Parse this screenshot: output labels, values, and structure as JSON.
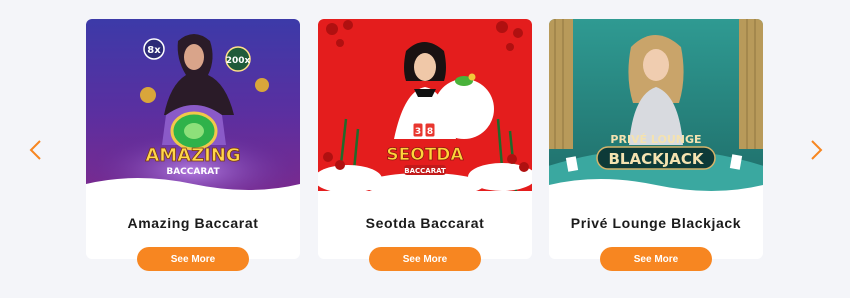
{
  "carousel": {
    "prev_icon": "chevron-left-icon",
    "next_icon": "chevron-right-icon",
    "accent": "#f78621",
    "cards": [
      {
        "title": "Amazing Baccarat",
        "logo_line1": "AMAZING",
        "logo_line2": "BACCARAT",
        "multipliers": [
          "8x",
          "200x"
        ],
        "button": "See More"
      },
      {
        "title": "Seotda Baccarat",
        "logo_line1": "SEOTDA",
        "logo_line2": "BACCARAT",
        "card_numbers": [
          "3",
          "8"
        ],
        "button": "See More"
      },
      {
        "title": "Privé Lounge Blackjack",
        "logo_line1": "PRIVÉ LOUNGE",
        "logo_line2": "BLACKJACK",
        "button": "See More"
      }
    ]
  }
}
